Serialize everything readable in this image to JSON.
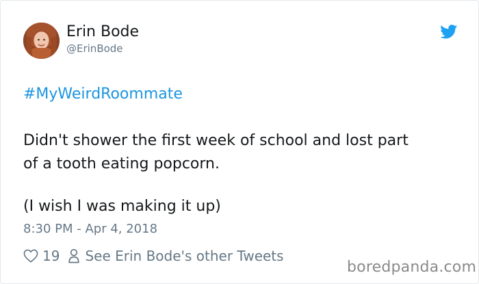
{
  "author": {
    "name": "Erin Bode",
    "handle": "@ErinBode"
  },
  "tweet": {
    "hashtag": "#MyWeirdRoommate",
    "text_lines": [
      "Didn't shower the first week of school and lost part",
      "of a tooth eating popcorn."
    ],
    "extra": "(I wish I was making it up)",
    "timestamp": "8:30 PM - Apr 4, 2018"
  },
  "actions": {
    "like_count": "19",
    "profile_link": "See Erin Bode's other Tweets"
  },
  "watermark": "boredpanda.com",
  "colors": {
    "link": "#1b95e0",
    "twitter_blue": "#1da1f2",
    "muted": "#657786",
    "text": "#14171a",
    "watermark": "#8a8a8a"
  },
  "icons": {
    "brand": "twitter-bird-icon",
    "like": "heart-icon",
    "profile": "person-icon"
  }
}
